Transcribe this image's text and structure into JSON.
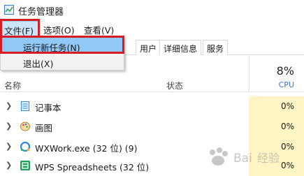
{
  "window": {
    "title": "任务管理器"
  },
  "menu": {
    "file": "文件(F)",
    "options": "选项(O)",
    "view": "查看(V)"
  },
  "tabs": [
    {
      "label": "用户"
    },
    {
      "label": "详细信息"
    },
    {
      "label": "服务"
    }
  ],
  "columns": {
    "name": "名称",
    "status": "状态",
    "cpu_percent": "8%",
    "cpu_label": "CPU"
  },
  "processes": [
    {
      "name": "记事本",
      "cpu": "0%",
      "icon": "notepad-icon"
    },
    {
      "name": "画图",
      "cpu": "0%",
      "icon": "paint-icon"
    },
    {
      "name": "WXWork.exe (32 位) (9)",
      "cpu": "0%",
      "icon": "wxwork-icon"
    },
    {
      "name": "WPS Spreadsheets (32 位)",
      "cpu": "0%",
      "icon": "wps-spreadsheets-icon"
    }
  ],
  "file_menu": {
    "run_new_task": "运行新任务(N)",
    "exit": "退出(X)"
  },
  "colors": {
    "highlight": "#90c8f6",
    "cpu_column": "#fff4c4",
    "red_annotation": "#d71c24",
    "cpu_accent": "#3c78c8"
  }
}
